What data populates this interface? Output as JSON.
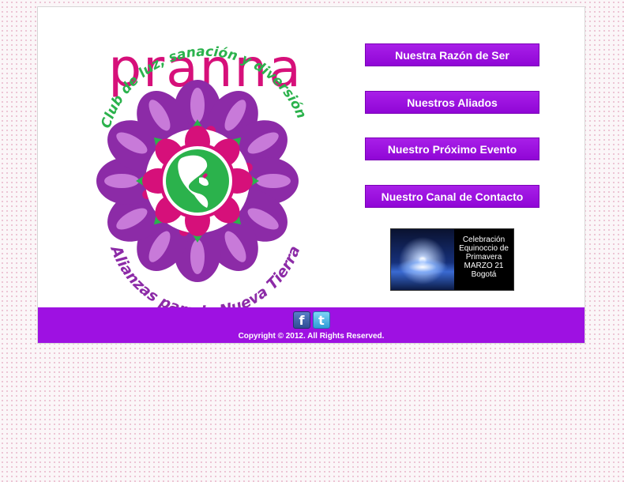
{
  "logo": {
    "brand": "pranna",
    "tagline": "Club de luz, sanación y diversión",
    "subtitle": "Alianzas para la Nueva Tierra"
  },
  "nav": {
    "items": [
      {
        "label": "Nuestra Razón de Ser"
      },
      {
        "label": "Nuestros Aliados"
      },
      {
        "label": "Nuestro Próximo Evento"
      },
      {
        "label": "Nuestro Canal de Contacto"
      }
    ]
  },
  "event": {
    "text": "Celebración\nEquinoccio de\nPrimavera\nMARZO 21\nBogotá"
  },
  "footer": {
    "facebook_icon": "facebook-icon",
    "twitter_icon": "twitter-icon",
    "copyright": "Copyright © 2012. All Rights Reserved."
  },
  "colors": {
    "accent_purple": "#9e11e2",
    "logo_purple": "#8c2ba7",
    "logo_magenta": "#d6107a",
    "logo_green": "#2bb24c"
  }
}
